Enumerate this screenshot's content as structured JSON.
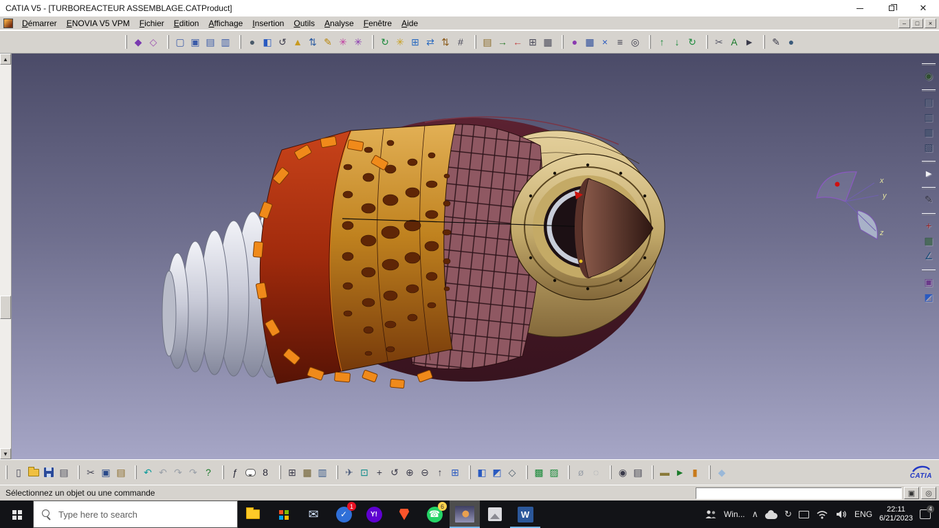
{
  "window": {
    "title": "CATIA V5 - [TURBOREACTEUR ASSEMBLAGE.CATProduct]"
  },
  "menubar": {
    "items": [
      {
        "label": "Démarrer"
      },
      {
        "label": "ENOVIA V5 VPM"
      },
      {
        "label": "Fichier"
      },
      {
        "label": "Edition"
      },
      {
        "label": "Affichage"
      },
      {
        "label": "Insertion"
      },
      {
        "label": "Outils"
      },
      {
        "label": "Analyse"
      },
      {
        "label": "Fenêtre"
      },
      {
        "label": "Aide"
      }
    ]
  },
  "viewport": {
    "background_top": "#4b4b68",
    "background_bottom": "#a6a6c6",
    "model_colors": {
      "outer_shell": "#45131f",
      "combustor_band": "#b53210",
      "flange_lugs": "#f08a1a",
      "perforated_drum": "#c98a2e",
      "mesh_section": "#8f5862",
      "intake_bellows": "#d6d8e2",
      "nozzle_disc": "#d2bc82",
      "exhaust_cone": "#5a332a"
    }
  },
  "compass": {
    "x_label": "x",
    "y_label": "y",
    "z_label": "z"
  },
  "mini_axes": {
    "x_label": "x",
    "y_label": "y",
    "z_label": "z"
  },
  "statusbar": {
    "message": "Sélectionnez un objet ou une commande",
    "command_value": ""
  },
  "branding": {
    "logo_text": "CATIA"
  },
  "taskbar": {
    "search_placeholder": "Type here to search",
    "win_label": "Win...",
    "language": "ENG",
    "clock_time": "22:11",
    "clock_date": "6/21/2023",
    "badges": {
      "todo": "1",
      "whatsapp": "6",
      "notifications": "4"
    },
    "app_labels": {
      "word": "W",
      "yahoo": "Y!"
    }
  },
  "toolbars": {
    "top": [
      [
        {
          "n": "enovia-workbench-icon",
          "g": "◆",
          "c": "#7a3ab0"
        },
        {
          "n": "product-structure-workbench-icon",
          "g": "◇",
          "c": "#9a4ab0"
        }
      ],
      [
        {
          "n": "new-component-icon",
          "g": "▢",
          "c": "#3a5aa8"
        },
        {
          "n": "new-product-icon",
          "g": "▣",
          "c": "#3a5aa8"
        },
        {
          "n": "new-part-icon",
          "g": "▤",
          "c": "#3a5aa8"
        },
        {
          "n": "existing-component-icon",
          "g": "▥",
          "c": "#3a5aa8"
        }
      ],
      [
        {
          "n": "shaded-sphere-icon",
          "g": "●",
          "c": "#4a5a6a"
        },
        {
          "n": "iso-cube-icon",
          "g": "◧",
          "c": "#2a5ac0"
        },
        {
          "n": "rotate-view-icon",
          "g": "↺",
          "c": "#3a3a4a"
        },
        {
          "n": "cone-tool-icon",
          "g": "▲",
          "c": "#c89a20"
        },
        {
          "n": "swap-axes-icon",
          "g": "⇅",
          "c": "#2a5aa0"
        },
        {
          "n": "sketcher-icon",
          "g": "✎",
          "c": "#b8860b"
        },
        {
          "n": "color-swirl-icon",
          "g": "✳",
          "c": "#c03aa0"
        },
        {
          "n": "gear-settings-icon",
          "g": "✳",
          "c": "#8a3ab0"
        }
      ],
      [
        {
          "n": "update-icon",
          "g": "↻",
          "c": "#1a8a3a"
        },
        {
          "n": "gear-yellow-icon",
          "g": "✳",
          "c": "#c8a020"
        },
        {
          "n": "insert-component-icon",
          "g": "⊞",
          "c": "#2a6ac0"
        },
        {
          "n": "replace-component-icon",
          "g": "⇄",
          "c": "#2a6ac0"
        },
        {
          "n": "reorder-tree-icon",
          "g": "⇅",
          "c": "#8a5a1a"
        },
        {
          "n": "generate-numbering-icon",
          "g": "#",
          "c": "#4a4a5a"
        }
      ],
      [
        {
          "n": "paste-special-icon",
          "g": "▤",
          "c": "#8a6a2a"
        },
        {
          "n": "fast-instantiation-icon",
          "g": "→",
          "c": "#2a7a2a"
        },
        {
          "n": "break-link-icon",
          "g": "←",
          "c": "#c04040"
        },
        {
          "n": "design-table-top-icon",
          "g": "⊞",
          "c": "#4a4a5a"
        },
        {
          "n": "analyze-table-icon",
          "g": "▦",
          "c": "#4a4a5a"
        }
      ],
      [
        {
          "n": "publication-sphere-icon",
          "g": "●",
          "c": "#8a3ab0"
        },
        {
          "n": "save-management-icon",
          "g": "▦",
          "c": "#2a4a9a"
        },
        {
          "n": "close-document-icon",
          "g": "×",
          "c": "#2a5ac0"
        },
        {
          "n": "specification-tree-icon",
          "g": "≡",
          "c": "#3a3a4a"
        },
        {
          "n": "search-icon",
          "g": "◎",
          "c": "#3a3a4a"
        }
      ],
      [
        {
          "n": "export-document-icon",
          "g": "↑",
          "c": "#1a8a3a"
        },
        {
          "n": "import-document-icon",
          "g": "↓",
          "c": "#1a8a3a"
        },
        {
          "n": "synchronize-icon",
          "g": "↻",
          "c": "#1a8a3a"
        }
      ],
      [
        {
          "n": "trim-icon",
          "g": "✂",
          "c": "#5a5a6a"
        },
        {
          "n": "spell-check-icon",
          "g": "A",
          "c": "#1a7a2a"
        },
        {
          "n": "select-pointer-icon",
          "g": "►",
          "c": "#3a3a4a"
        }
      ],
      [
        {
          "n": "pen-icon",
          "g": "✎",
          "c": "#3a3a4a"
        },
        {
          "n": "user-profile-icon",
          "g": "●",
          "c": "#3a5a7a"
        }
      ]
    ],
    "bottom": [
      [
        {
          "n": "new-file-icon",
          "g": "▯",
          "c": "#4a4a5a"
        },
        {
          "n": "open-folder-icon",
          "cls": "folder"
        },
        {
          "n": "save-icon",
          "cls": "floppy"
        },
        {
          "n": "print-icon",
          "g": "▤",
          "c": "#4a4a5a"
        }
      ],
      [
        {
          "n": "cut-icon",
          "g": "✂",
          "c": "#4a4a5a"
        },
        {
          "n": "copy-icon",
          "g": "▣",
          "c": "#2a4a8a"
        },
        {
          "n": "paste-icon",
          "g": "▤",
          "c": "#8a6a2a"
        }
      ],
      [
        {
          "n": "undo-icon",
          "g": "↶",
          "c": "#0a9a9a"
        },
        {
          "n": "undo-history-icon",
          "g": "↶",
          "c": "#9aa0a8"
        },
        {
          "n": "redo-icon",
          "g": "↷",
          "c": "#9aa0a8"
        },
        {
          "n": "redo-history-icon",
          "g": "↷",
          "c": "#9aa0a8"
        },
        {
          "n": "whats-this-icon",
          "g": "?",
          "c": "#1a7a2a"
        }
      ],
      [
        {
          "n": "formula-icon",
          "g": "ƒ",
          "c": "#2a2a3a"
        },
        {
          "n": "comment-bubble-icon",
          "cls": "bubble"
        },
        {
          "n": "datum-icon",
          "g": "8",
          "c": "#2a2a3a"
        }
      ],
      [
        {
          "n": "design-table-icon",
          "g": "⊞",
          "c": "#3a3a4a"
        },
        {
          "n": "catalog-browser-icon",
          "g": "▦",
          "c": "#6a5a2a"
        },
        {
          "n": "knowledge-inspector-icon",
          "g": "▥",
          "c": "#3a5a8a"
        }
      ],
      [
        {
          "n": "fly-mode-icon",
          "g": "✈",
          "c": "#4a5a7a"
        },
        {
          "n": "fit-all-in-icon",
          "g": "⊡",
          "c": "#0a8a8a"
        },
        {
          "n": "pan-icon",
          "g": "+",
          "c": "#3a3a4a"
        },
        {
          "n": "rotate-icon",
          "g": "↺",
          "c": "#3a3a4a"
        },
        {
          "n": "zoom-in-icon",
          "g": "⊕",
          "c": "#3a3a4a"
        },
        {
          "n": "zoom-out-icon",
          "g": "⊖",
          "c": "#3a3a4a"
        },
        {
          "n": "normal-view-icon",
          "g": "↑",
          "c": "#3a3a4a"
        },
        {
          "n": "multi-view-icon",
          "g": "⊞",
          "c": "#2a5ac0"
        }
      ],
      [
        {
          "n": "iso-view-icon",
          "g": "◧",
          "c": "#2a5ac0"
        },
        {
          "n": "shaded-view-icon",
          "g": "◩",
          "c": "#2a5ac0"
        },
        {
          "n": "wireframe-view-icon",
          "g": "◇",
          "c": "#4a5a6a"
        }
      ],
      [
        {
          "n": "apply-material-icon",
          "g": "▩",
          "c": "#1a8a3a"
        },
        {
          "n": "graphic-properties-icon",
          "g": "▨",
          "c": "#1a8a3a"
        }
      ],
      [
        {
          "n": "hide-show-icon",
          "g": "ø",
          "c": "#9aa0a8"
        },
        {
          "n": "swap-visible-space-icon",
          "g": "◌",
          "c": "#9aa0a8"
        }
      ],
      [
        {
          "n": "capture-icon",
          "g": "◉",
          "c": "#3a3a4a"
        },
        {
          "n": "quick-print-icon",
          "g": "▤",
          "c": "#3a3a4a"
        }
      ],
      [
        {
          "n": "measure-ruler-icon",
          "g": "▬",
          "c": "#8a7a3a"
        },
        {
          "n": "macro-play-icon",
          "g": "►",
          "c": "#1a7a2a"
        },
        {
          "n": "material-cylinder-icon",
          "g": "▮",
          "c": "#c87a1a"
        }
      ],
      [
        {
          "n": "eraser-wedge-icon",
          "g": "◆",
          "c": "#9ab8d8"
        }
      ]
    ],
    "right": [
      [
        {
          "n": "fly-through-icon",
          "g": "◉",
          "c": "#2f4f2f"
        }
      ],
      [
        {
          "n": "tree-list-icon",
          "g": "▤",
          "c": "#2a3a5a"
        },
        {
          "n": "tree-table-icon",
          "g": "▥",
          "c": "#2a3a5a"
        },
        {
          "n": "tree-graph-icon",
          "g": "▦",
          "c": "#2a3a5a"
        },
        {
          "n": "tree-filter-icon",
          "g": "▧",
          "c": "#2a3a5a"
        }
      ],
      [
        {
          "n": "select-arrow-icon",
          "g": "►",
          "c": "#f0f0f4"
        }
      ],
      [
        {
          "n": "pencil-tool-icon",
          "g": "✎",
          "c": "#2a2a3a"
        }
      ],
      [
        {
          "n": "axis-system-icon",
          "g": "+",
          "c": "#a02020"
        },
        {
          "n": "catalog-icon",
          "g": "▦",
          "c": "#20512e"
        },
        {
          "n": "measure-angle-icon",
          "g": "∠",
          "c": "#204f7a"
        }
      ],
      [
        {
          "n": "lock-icon",
          "g": "▣",
          "c": "#6a3a8a"
        },
        {
          "n": "render-tools-icon",
          "g": "◩",
          "c": "#2a5ac0"
        }
      ]
    ]
  }
}
